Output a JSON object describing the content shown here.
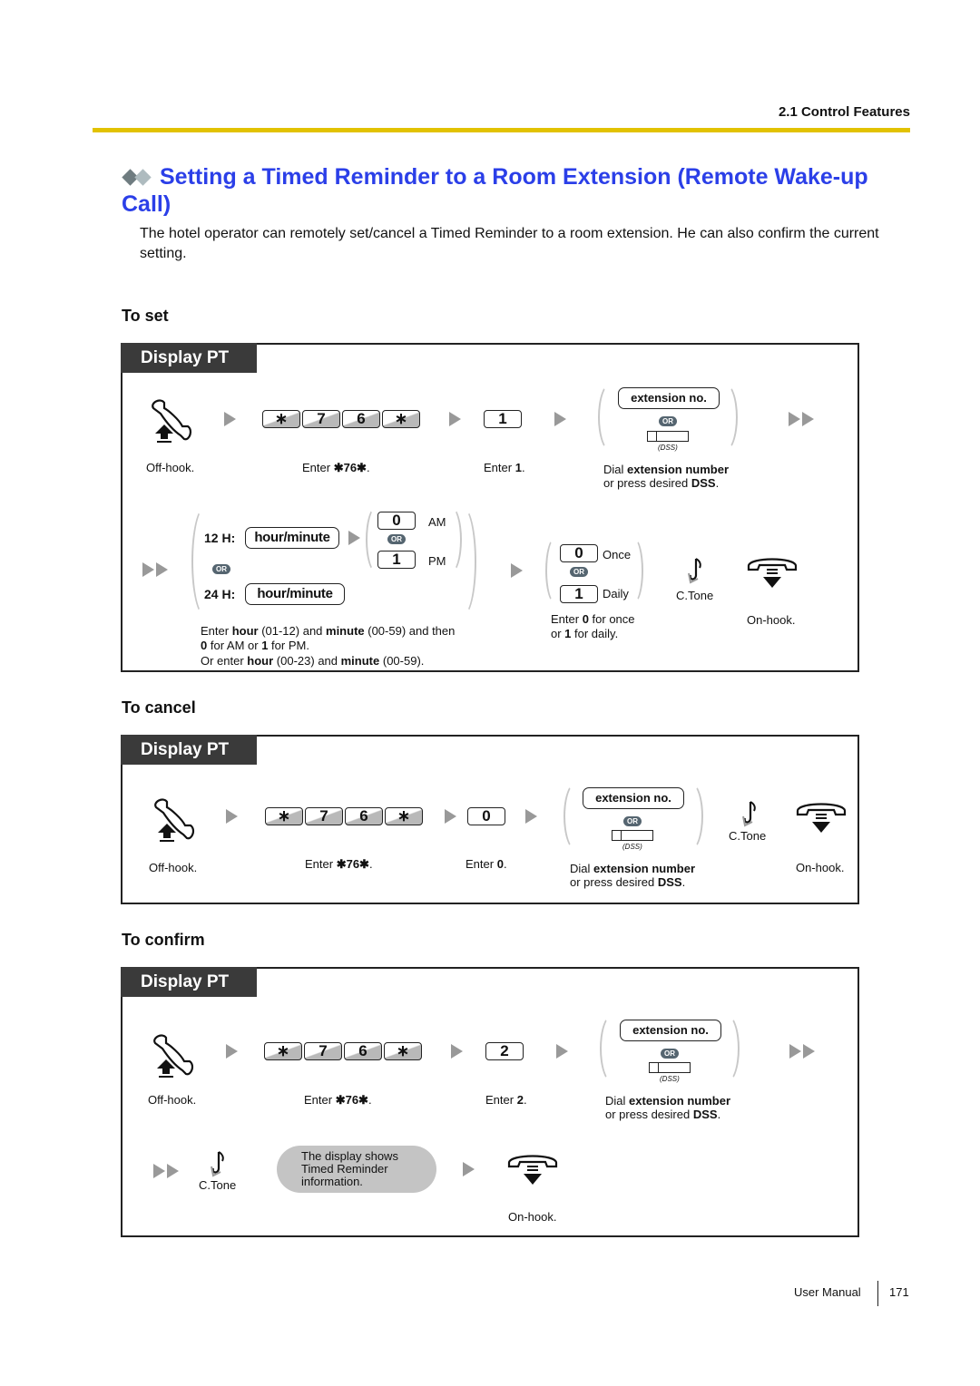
{
  "header": {
    "section": "2.1 Control Features",
    "rule_color": "#e2c200"
  },
  "title": {
    "icon": "double-diamond-icon",
    "text": "Setting a Timed Reminder to a Room Extension (Remote Wake-up Call)",
    "color": "#2b3fe8"
  },
  "intro": "The hotel operator can remotely set/cancel a Timed Reminder to a room extension. He can also confirm the current setting.",
  "common": {
    "panel_tab": "Display PT",
    "off_hook": "Off-hook.",
    "on_hook": "On-hook.",
    "enter_prefix": "Enter",
    "feature_code_caption": "✱76✱",
    "feature_keys": [
      "∗",
      "7",
      "6",
      "∗"
    ],
    "extension_pill": "extension no.",
    "or_badge": "OR",
    "dss_label": "(DSS)",
    "dial_caption_1_pre": "Dial",
    "dial_caption_1_bold": "extension number",
    "dial_caption_2_pre": "or press desired",
    "dial_caption_2_bold": "DSS",
    "dial_caption_2_post": ".",
    "ctone": "C.Tone"
  },
  "to_set": {
    "heading": "To set",
    "digit": "1",
    "enter_digit_caption_bold": "1",
    "time": {
      "h12_label": "12 H:",
      "h24_label": "24 H:",
      "pill": "hour/minute",
      "am_key": "0",
      "am_label": "AM",
      "pm_key": "1",
      "pm_label": "PM",
      "caption": [
        {
          "t": "Enter "
        },
        {
          "b": "hour"
        },
        {
          "t": " (01-12) and "
        },
        {
          "b": "minute"
        },
        {
          "t": " (00-59) and then"
        }
      ],
      "caption_line2": [
        {
          "b": "0"
        },
        {
          "t": " for AM or "
        },
        {
          "b": "1"
        },
        {
          "t": " for PM."
        }
      ],
      "caption_line3": [
        {
          "t": "Or enter "
        },
        {
          "b": "hour"
        },
        {
          "t": " (00-23) and "
        },
        {
          "b": "minute"
        },
        {
          "t": " (00-59)."
        }
      ]
    },
    "repeat": {
      "once_key": "0",
      "once_label": "Once",
      "daily_key": "1",
      "daily_label": "Daily",
      "caption_line1": [
        {
          "t": "Enter "
        },
        {
          "b": "0"
        },
        {
          "t": " for once"
        }
      ],
      "caption_line2": [
        {
          "t": "or "
        },
        {
          "b": "1"
        },
        {
          "t": " for daily."
        }
      ]
    }
  },
  "to_cancel": {
    "heading": "To cancel",
    "digit": "0",
    "enter_digit_caption_bold": "0"
  },
  "to_confirm": {
    "heading": "To confirm",
    "digit": "2",
    "enter_digit_caption_bold": "2",
    "display_bubble": [
      "The display shows",
      "Timed Reminder",
      "information."
    ]
  },
  "footer": {
    "label": "User Manual",
    "page": "171"
  }
}
